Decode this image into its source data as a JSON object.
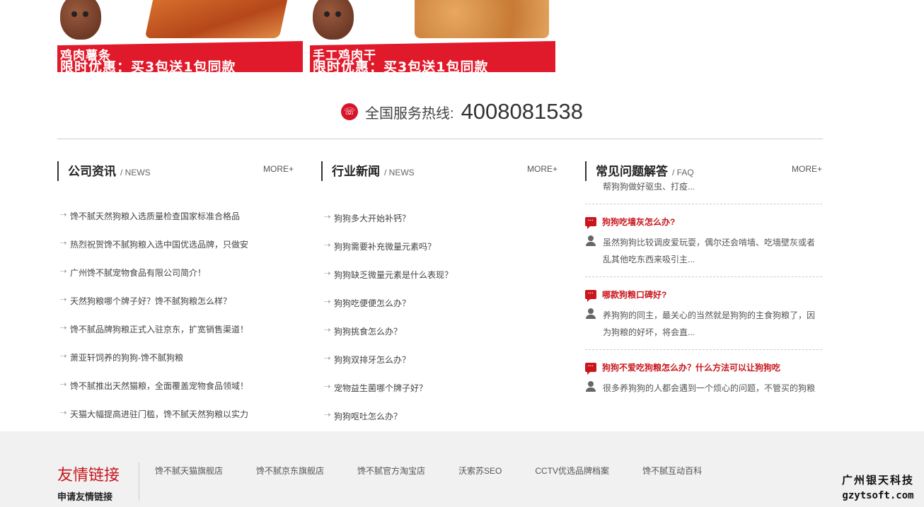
{
  "banners": [
    {
      "line1": "鸡肉薯条",
      "line2": "限时优惠：买3包送1包同款"
    },
    {
      "line1": "手工鸡肉干",
      "line2": "限时优惠：买3包送1包同款"
    }
  ],
  "hotline": {
    "label": "全国服务热线:",
    "number": "4008081538"
  },
  "company_news": {
    "title": "公司资讯",
    "sub": "/ NEWS",
    "more": "MORE+",
    "items": [
      "馋不腻天然狗粮入选质量检查国家标准合格品",
      "热烈祝贺馋不腻狗粮入选中国优选品牌，只做安",
      "广州馋不腻宠物食品有限公司简介！",
      "天然狗粮哪个牌子好？馋不腻狗粮怎么样？",
      "馋不腻品牌狗粮正式入驻京东，扩宽销售渠道！",
      "萧亚轩饲养的狗狗-馋不腻狗粮",
      "馋不腻推出天然猫粮，全面覆盖宠物食品领域！",
      "天猫大幅提高进驻门槛，馋不腻天然狗粮以实力"
    ]
  },
  "industry_news": {
    "title": "行业新闻",
    "sub": "/ NEWS",
    "more": "MORE+",
    "items": [
      "狗狗多大开始补钙？",
      "狗狗需要补充微量元素吗？",
      "狗狗缺乏微量元素是什么表现？",
      "狗狗吃便便怎么办？",
      "狗狗挑食怎么办？",
      "狗狗双排牙怎么办？",
      "宠物益生菌哪个牌子好？",
      "狗狗呕吐怎么办？"
    ]
  },
  "faq": {
    "title": "常见问题解答",
    "sub": "/ FAQ",
    "more": "MORE+",
    "cut_answer": "帮狗狗做好驱虫、打疫...",
    "items": [
      {
        "q": "狗狗吃墙灰怎么办?",
        "a": "虽然狗狗比较调皮爱玩耍，偶尔还会啃墙、吃墙壁灰或者乱其他吃东西来吸引主..."
      },
      {
        "q": "哪款狗粮口碑好?",
        "a": "养狗狗的同主，最关心的当然就是狗狗的主食狗粮了，因为狗粮的好坏，将会直..."
      },
      {
        "q": "狗狗不爱吃狗粮怎么办？什么方法可以让狗狗吃",
        "a": "很多养狗狗的人都会遇到一个烦心的问题，不管买的狗粮"
      }
    ]
  },
  "footer": {
    "friend_title": "友情链接",
    "apply": "申请友情链接",
    "links": [
      "馋不腻天猫旗舰店",
      "馋不腻京东旗舰店",
      "馋不腻官方淘宝店",
      "沃索苏SEO",
      "CCTV优选品牌档案",
      "馋不腻互动百科"
    ]
  },
  "watermark": {
    "line1": "广州银天科技",
    "line2": "gzytsoft.com"
  }
}
